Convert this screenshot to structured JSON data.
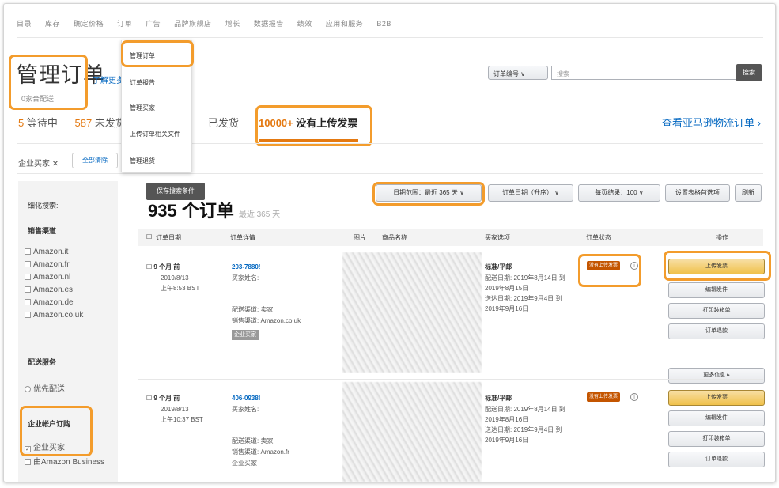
{
  "topnav": [
    "目录",
    "库存",
    "确定价格",
    "订单",
    "广告",
    "品牌旗舰店",
    "增长",
    "数据报告",
    "绩效",
    "应用和服务",
    "B2B"
  ],
  "dropdown": {
    "items": [
      "管理订单",
      "订单报告",
      "管理买家",
      "上传订单相关文件",
      "管理退货"
    ]
  },
  "header": {
    "title": "管理订单",
    "learn_more": "了解更多",
    "subtitle": "0家合配送"
  },
  "status_tabs": [
    {
      "num": "5",
      "label": "等待中"
    },
    {
      "num": "587",
      "label": "未发货"
    },
    {
      "num": "",
      "label": "已发货"
    }
  ],
  "active_tab": {
    "num": "10000+",
    "label": "没有上传发票"
  },
  "view_link": "查看亚马逊物流订单 ›",
  "search": {
    "select": "订单编号",
    "placeholder": "搜索",
    "button": "搜索"
  },
  "filter": {
    "label": "企业买家",
    "clear": "全部清除"
  },
  "sidebar": {
    "refine": "细化搜索:",
    "channel_heading": "销售渠道",
    "channels": [
      "Amazon.it",
      "Amazon.fr",
      "Amazon.nl",
      "Amazon.es",
      "Amazon.de",
      "Amazon.co.uk"
    ],
    "delivery_heading": "配送服务",
    "delivery": [
      "优先配送"
    ],
    "business_heading": "企业帐户订购",
    "business": [
      "企业买家",
      "由Amazon Business"
    ]
  },
  "save_button": "保存搜索条件",
  "order_count": {
    "count": "935 个订单",
    "range": "最近 365 天"
  },
  "controls": {
    "date_range": "日期范围：最近 365 天 ∨",
    "sort": "订单日期（升序） ∨",
    "per_page": "每页结果：100 ∨",
    "prefs": "设置表格首选项",
    "refresh": "刷新"
  },
  "table_headers": [
    "订单日期",
    "订单详情",
    "图片",
    "商品名称",
    "买家选项",
    "订单状态",
    "操作"
  ],
  "orders": [
    {
      "age": "9 个月 前",
      "date": "2019/8/13",
      "time": "上午8:53 BST",
      "id": "203-7880!",
      "buyer": "买家姓名:",
      "ship_by": "配送渠道: 卖家",
      "channel": "销售渠道: Amazon.co.uk",
      "tag": "企业买家",
      "option": "标准/平邮",
      "ship_date": "配送日期: 2019年8月14日 到",
      "ship_date2": "2019年8月15日",
      "delivery_date": "送达日期: 2019年9月4日 到",
      "delivery_date2": "2019年9月16日",
      "status": "没有上传发票",
      "actions": [
        "上传发票",
        "编辑发件",
        "打印装箱单",
        "订单退款"
      ],
      "more": "更多信息 ▸"
    },
    {
      "age": "9 个月 前",
      "date": "2019/8/13",
      "time": "上午10:37 BST",
      "id": "406-0938!",
      "buyer": "买家姓名:",
      "ship_by": "配送渠道: 卖家",
      "channel": "销售渠道: Amazon.fr",
      "tag": "企业买家",
      "option": "标准/平邮",
      "ship_date": "配送日期: 2019年8月14日 到",
      "ship_date2": "2019年8月16日",
      "delivery_date": "送达日期: 2019年9月4日 到",
      "delivery_date2": "2019年9月16日",
      "status": "没有上传发票",
      "actions": [
        "上传发票",
        "编辑发件",
        "打印装箱单",
        "订单退款"
      ]
    }
  ]
}
